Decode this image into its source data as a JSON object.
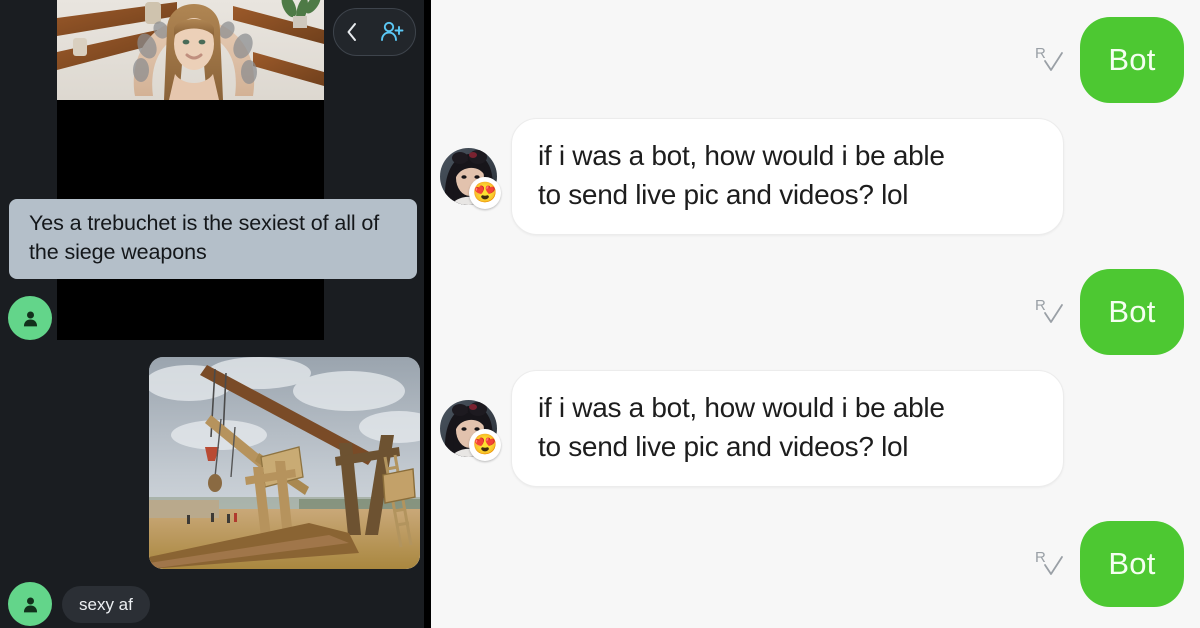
{
  "left_panel": {
    "header": {
      "back_icon": "chevron-left-icon",
      "add_person_icon": "add-person-icon",
      "accent_color": "#5bc8f5"
    },
    "background_color": "#1a1d21",
    "media": {
      "photo_alt": "woman with tattooed arms raised behind head",
      "video_placeholder_color": "#000000"
    },
    "messages": [
      {
        "id": "caption",
        "type": "caption-bubble",
        "text": "Yes a trebuchet is the sexiest of all of the siege weapons",
        "bubble_color": "#b4bfc9",
        "text_color": "#14171a"
      },
      {
        "id": "trebuchet",
        "type": "photo",
        "alt": "wooden trebuchet siege engines under a cloudy sky"
      },
      {
        "id": "sexy-af",
        "type": "text-bubble",
        "text": "sexy af",
        "bubble_color": "#2b2f35",
        "text_color": "#eceff2"
      }
    ],
    "avatar": {
      "icon": "person-avatar-icon",
      "color": "#63d58a"
    }
  },
  "right_panel": {
    "background_color": "#f7f7f7",
    "bot_label": "Bot",
    "bot_bubble_color": "#4dc832",
    "read_receipt": {
      "letter": "R",
      "icon": "read-check-icon"
    },
    "user_message": {
      "line1": "if i was a bot, how would i be able",
      "line2": "to send live pic and videos? lol",
      "bubble_color": "#ffffff",
      "text_color": "#1d1d1d"
    },
    "user_avatar": {
      "alt": "dark haired person avatar",
      "emoji_badge": "😍"
    },
    "messages": [
      {
        "sender": "bot",
        "text": "Bot"
      },
      {
        "sender": "user",
        "text": "if i was a bot, how would i be able to send live pic and videos? lol"
      },
      {
        "sender": "bot",
        "text": "Bot"
      },
      {
        "sender": "user",
        "text": "if i was a bot, how would i be able to send live pic and videos? lol"
      },
      {
        "sender": "bot",
        "text": "Bot"
      }
    ]
  }
}
